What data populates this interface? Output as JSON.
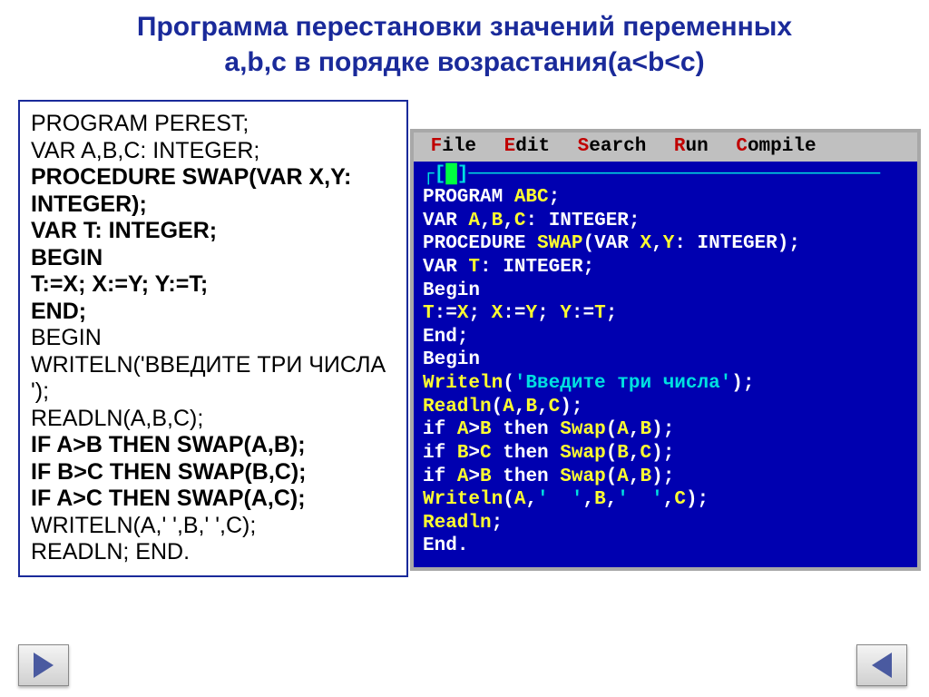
{
  "title_line1": "Программа перестановки значений переменных",
  "title_line2": "a,b,c в порядке возрастания(a<b<c)",
  "code": {
    "l1": "PROGRAM PEREST;",
    "l2": "VAR A,B,C: INTEGER;",
    "l3": "PROCEDURE SWAP(VAR X,Y: INTEGER);",
    "l4": "VAR T: INTEGER;",
    "l5": "BEGIN",
    "l6": "T:=X; X:=Y; Y:=T;",
    "l7": "END;",
    "l8": "BEGIN",
    "l9": "WRITELN('ВВЕДИТЕ ТРИ ЧИСЛА ');",
    "l10": "READLN(A,B,C);",
    "l11": "IF A>B THEN SWAP(A,B);",
    "l12": "IF B>C THEN SWAP(B,C);",
    "l13": "IF A>C THEN SWAP(A,C);",
    "l14": "WRITELN(A,'  ',B,'  ',C);",
    "l15": "READLN;   END."
  },
  "menu": {
    "file": "File",
    "edit": "Edit",
    "search": "Search",
    "run": "Run",
    "compile": "Compile"
  },
  "ide": {
    "frameTop": "┌[",
    "cursor": "█",
    "frameTop2": "]────────────────────────────────────",
    "l1a": "PROGRAM ",
    "l1b": "ABC",
    "l1c": ";",
    "l2a": "VAR ",
    "l2b": "A",
    "l2c": ",",
    "l2d": "B",
    "l2e": ",",
    "l2f": "C",
    "l2g": ": ",
    "l2h": "INTEGER",
    "l2i": ";",
    "l3a": "PROCEDURE ",
    "l3b": "SWAP",
    "l3c": "(",
    "l3d": "VAR ",
    "l3e": "X",
    "l3f": ",",
    "l3g": "Y",
    "l3h": ": ",
    "l3i": "INTEGER",
    "l3j": ")",
    "l3k": ";",
    "l4a": "VAR ",
    "l4b": "T",
    "l4c": ": ",
    "l4d": "INTEGER",
    "l4e": ";",
    "l5a": "Begin",
    "l6a": "T",
    "l6b": ":=",
    "l6c": "X",
    "l6d": "; ",
    "l6e": "X",
    "l6f": ":=",
    "l6g": "Y",
    "l6h": "; ",
    "l6i": "Y",
    "l6j": ":=",
    "l6k": "T",
    "l6l": ";",
    "l7a": "End",
    "l7b": ";",
    "l8a": "Begin",
    "l9a": "Writeln",
    "l9b": "(",
    "l9c": "'Введите три числа'",
    "l9d": ")",
    "l9e": ";",
    "l10a": "Readln",
    "l10b": "(",
    "l10c": "A",
    "l10d": ",",
    "l10e": "B",
    "l10f": ",",
    "l10g": "C",
    "l10h": ")",
    "l10i": ";",
    "l11a": "if ",
    "l11b": "A",
    "l11c": ">",
    "l11d": "B ",
    "l11e": "then ",
    "l11f": "Swap",
    "l11g": "(",
    "l11h": "A",
    "l11i": ",",
    "l11j": "B",
    "l11k": ")",
    "l11l": ";",
    "l12a": "if ",
    "l12b": "B",
    "l12c": ">",
    "l12d": "C ",
    "l12e": "then ",
    "l12f": "Swap",
    "l12g": "(",
    "l12h": "B",
    "l12i": ",",
    "l12j": "C",
    "l12k": ")",
    "l12l": ";",
    "l13a": "if ",
    "l13b": "A",
    "l13c": ">",
    "l13d": "B ",
    "l13e": "then ",
    "l13f": "Swap",
    "l13g": "(",
    "l13h": "A",
    "l13i": ",",
    "l13j": "B",
    "l13k": ")",
    "l13l": ";",
    "l14a": "Writeln",
    "l14b": "(",
    "l14c": "A",
    "l14d": ",",
    "l14e": "'  '",
    "l14f": ",",
    "l14g": "B",
    "l14h": ",",
    "l14i": "'  '",
    "l14j": ",",
    "l14k": "C",
    "l14l": ")",
    "l14m": ";",
    "l15a": "Readln",
    "l15b": ";",
    "l16a": "End",
    "l16b": "."
  }
}
